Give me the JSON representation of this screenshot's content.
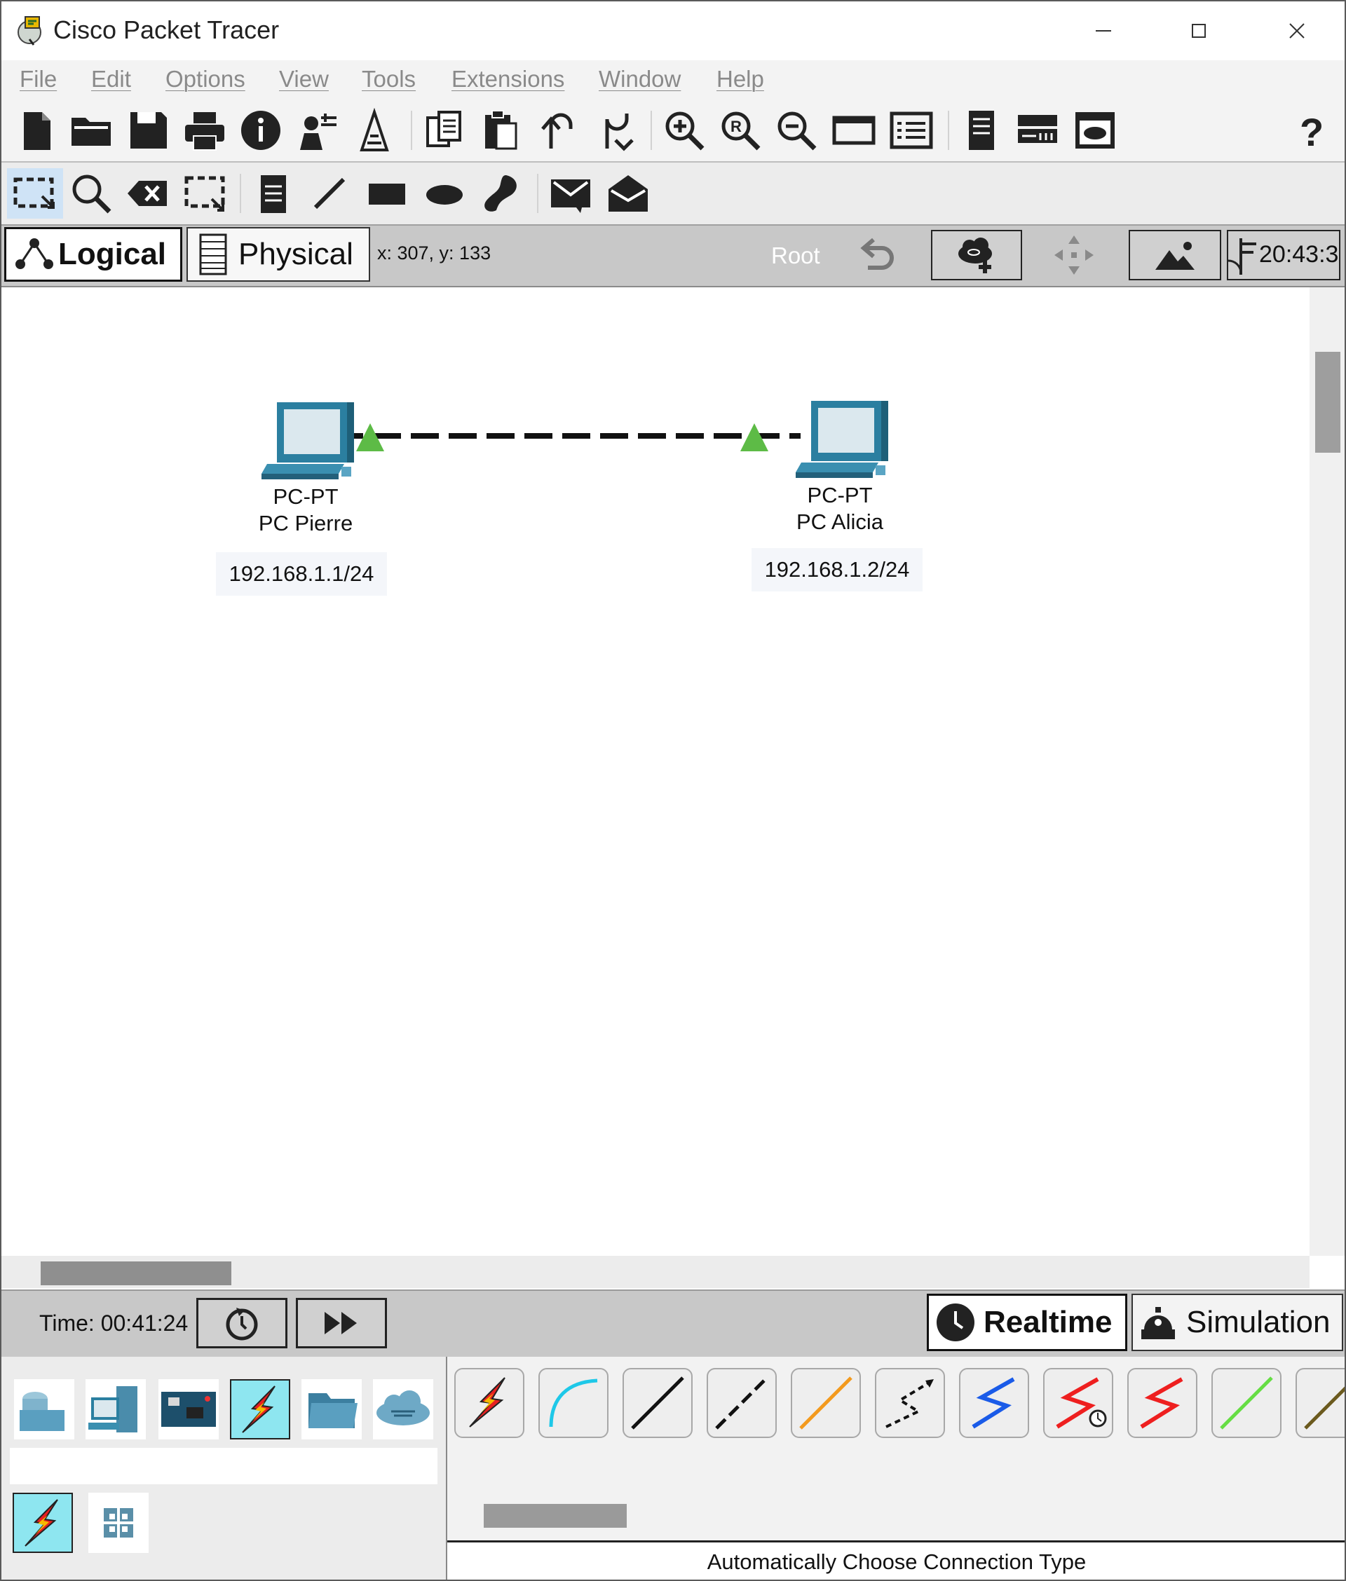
{
  "app": {
    "title": "Cisco Packet Tracer"
  },
  "menu": [
    "File",
    "Edit",
    "Options",
    "View",
    "Tools",
    "Extensions",
    "Window",
    "Help"
  ],
  "view_tabs": {
    "logical": "Logical",
    "physical": "Physical"
  },
  "workspace": {
    "coords_readout": "x: 307, y: 133",
    "root_label": "Root",
    "clock": "20:43:3"
  },
  "devices": [
    {
      "type": "PC-PT",
      "name": "PC Pierre",
      "ip": "192.168.1.1/24"
    },
    {
      "type": "PC-PT",
      "name": "PC Alicia",
      "ip": "192.168.1.2/24"
    }
  ],
  "link": {
    "cable": "crossover-dashed",
    "port_status_color": "#5dbb46"
  },
  "timebar": {
    "time": "Time: 00:41:24"
  },
  "modes": {
    "realtime": "Realtime",
    "simulation": "Simulation"
  },
  "device_categories": [
    "network-devices",
    "end-devices",
    "components",
    "connections",
    "miscellaneous",
    "multiuser"
  ],
  "connection_types": [
    "automatic",
    "console",
    "copper-straight",
    "copper-cross",
    "fiber",
    "phone",
    "coaxial",
    "serial-dce",
    "serial-dte",
    "octal",
    "iot-custom"
  ],
  "connection_status": "Automatically Choose Connection Type",
  "colors": {
    "accent_selected": "#8ee6f0",
    "canvas_bar": "#c8c8c8",
    "link_green": "#5dbb46"
  }
}
